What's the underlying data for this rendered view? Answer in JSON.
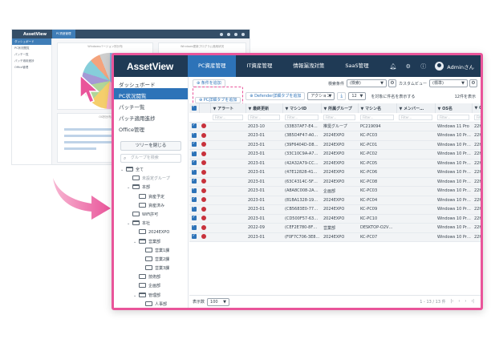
{
  "background_screen": {
    "logo": "AssetView",
    "active_tab": "PC資産管理",
    "side_items": [
      "ダッシュボード",
      "PC状況閲覧",
      "パッチ一覧",
      "パッチ適用進捗",
      "Office管理"
    ],
    "chart_title": "Windowsバージョン別分布",
    "chart_title_2": "Windows更新プログラム適用状況",
    "card_title_3": "OS別分布"
  },
  "header": {
    "logo": "AssetView",
    "tabs": [
      {
        "label": "PC資産管理",
        "active": true
      },
      {
        "label": "IT資産管理",
        "active": false
      },
      {
        "label": "情報漏洩対策",
        "active": false
      },
      {
        "label": "SaaS管理",
        "active": false
      }
    ],
    "user_name": "Adminさん"
  },
  "sidebar": {
    "items": [
      {
        "label": "ダッシュボード",
        "active": false
      },
      {
        "label": "PC状況閲覧",
        "active": true
      },
      {
        "label": "パッチ一覧",
        "active": false
      },
      {
        "label": "パッチ適用進捗",
        "active": false
      },
      {
        "label": "Office管理",
        "active": false
      }
    ],
    "tree_button": "ツリーを閉じる",
    "tree_search_placeholder": "グループを検索",
    "tree": [
      {
        "label": "全て",
        "indent": 0,
        "open": true,
        "chev": true
      },
      {
        "label": "未設定グループ",
        "indent": 1,
        "open": false,
        "chev": false,
        "muted": true
      },
      {
        "label": "本部",
        "indent": 1,
        "open": true,
        "chev": true
      },
      {
        "label": "資産予定",
        "indent": 2,
        "open": false,
        "chev": false
      },
      {
        "label": "資産済み",
        "indent": 2,
        "open": false,
        "chev": false
      },
      {
        "label": "WiFi許可",
        "indent": 1,
        "open": false,
        "chev": false
      },
      {
        "label": "本社",
        "indent": 1,
        "open": true,
        "chev": true
      },
      {
        "label": "2024EXPO",
        "indent": 2,
        "open": false,
        "chev": false
      },
      {
        "label": "営業部",
        "indent": 2,
        "open": true,
        "chev": true
      },
      {
        "label": "営業1課",
        "indent": 3,
        "open": false,
        "chev": false
      },
      {
        "label": "営業2課",
        "indent": 3,
        "open": false,
        "chev": false
      },
      {
        "label": "営業3課",
        "indent": 3,
        "open": false,
        "chev": false
      },
      {
        "label": "技術部",
        "indent": 2,
        "open": false,
        "chev": false
      },
      {
        "label": "企画部",
        "indent": 2,
        "open": false,
        "chev": false
      },
      {
        "label": "管理部",
        "indent": 2,
        "open": true,
        "chev": true
      },
      {
        "label": "人事部",
        "indent": 3,
        "open": false,
        "chev": false
      }
    ]
  },
  "toolbar": {
    "condition_button": "条件を追加",
    "search_condition_label": "検索条件",
    "search_condition_value": "(検索)",
    "custom_view_label": "カスタムビュー",
    "custom_view_value": "(標準)",
    "pc_info_button": "PC詳細タブを追加",
    "defender_button": "Defender詳細タブを追加",
    "action_select": "アクション",
    "page_size_value": "12",
    "export_label": "を対象に件名を表示する",
    "total_count": "12件を表示"
  },
  "table": {
    "columns": [
      "アラート",
      "最終更新",
      "マシンID",
      "所属グループ",
      "マシン名",
      "メンバー…",
      "OS名",
      "OS"
    ],
    "filter_placeholder": "Filter...",
    "rows": [
      [
        "2023-10",
        "(33B37AF7-E4…",
        "推奨グループ",
        "PC219094",
        "",
        "Windows 11 Pro",
        "22H"
      ],
      [
        "2023-01",
        "(3B5D4F47-A0…",
        "2024EXPO",
        "KC-PC03",
        "",
        "Windows 10 Pr…",
        "22H"
      ],
      [
        "2023-01",
        "(39F6404D-D8…",
        "2024EXPO",
        "KC-PC01",
        "",
        "Windows 10 Pr…",
        "22H"
      ],
      [
        "2023-01",
        "(33C10C9A-A7…",
        "2024EXPO",
        "KC-PC02",
        "",
        "Windows 10 Pr…",
        "22H"
      ],
      [
        "2023-01",
        "(42A32A79-CC…",
        "2024EXPO",
        "KC-PC05",
        "",
        "Windows 10 Pr…",
        "22H"
      ],
      [
        "2023-01",
        "(47E12828-41…",
        "2024EXPO",
        "KC-PC06",
        "",
        "Windows 10 Pr…",
        "22H"
      ],
      [
        "2023-01",
        "(63C4314C-5F…",
        "2024EXPO",
        "KC-PC08",
        "",
        "Windows 10 Pr…",
        "22H"
      ],
      [
        "2023-01",
        "(A8A8C008-2A…",
        "企画部",
        "KC-PC03",
        "",
        "Windows 10 Pr…",
        "22H"
      ],
      [
        "2023-01",
        "(81BA1328-19…",
        "2024EXPO",
        "KC-PC04",
        "",
        "Windows 10 Pr…",
        "22H"
      ],
      [
        "2023-01",
        "(CB5683E0-77…",
        "2024EXPO",
        "KC-PC09",
        "",
        "Windows 10 Pr…",
        "22H"
      ],
      [
        "2023-01",
        "(CD500F57-63…",
        "2024EXPO",
        "KC-PC10",
        "",
        "Windows 10 Pr…",
        "22H"
      ],
      [
        "2022-09",
        "(CEF2E780-8F…",
        "営業部",
        "DESKTOP-O2V…",
        "",
        "Windows 10 Pr…",
        "22H"
      ],
      [
        "2023-01",
        "(F0F7C706-3E8…",
        "2024EXPO",
        "KC-PC07",
        "",
        "Windows 10 Pr…",
        "22H"
      ]
    ]
  },
  "footer": {
    "page_label": "表示数",
    "page_size": "100",
    "pager": "1 - 13 / 13 件"
  },
  "colors": {
    "header_bg": "#1f3a55",
    "active_blue": "#2d73b8",
    "highlight_pink": "#e9559a",
    "alert_red": "#c8323c"
  }
}
